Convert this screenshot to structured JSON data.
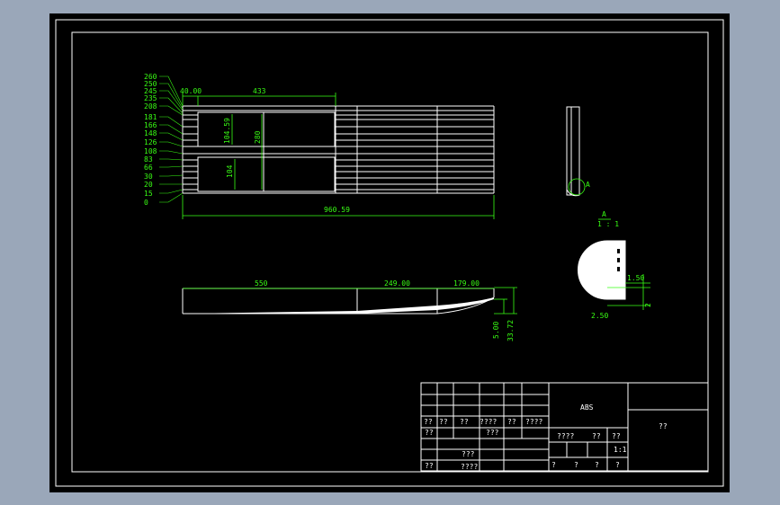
{
  "material": "ABS",
  "part_name": "??",
  "dims": {
    "width_total": "960.59",
    "top_length": "433",
    "top_offset": "40.00",
    "inner_h1": "104.59",
    "inner_h2": "280",
    "inner_h3": "104",
    "seg1": "550",
    "seg2": "249.00",
    "seg3": "179.00",
    "rise_small": "5.00",
    "rise_total": "33.72",
    "detail_w1": "1.50",
    "detail_w2": "2.50",
    "detail_h": "2"
  },
  "detail_label": "A",
  "detail_scale_top": "A",
  "detail_scale_bot": "1 : 1",
  "left_stack": [
    "260",
    "250",
    "245",
    "235",
    "208",
    "181",
    "166",
    "148",
    "126",
    "108",
    "83",
    "66",
    "30",
    "20",
    "15",
    "0"
  ],
  "title_block": {
    "row_signer_1": [
      "??",
      "??",
      "??",
      "????",
      "??",
      "????"
    ],
    "r2_a": "??",
    "r2_b": "???",
    "r3_a": "??",
    "r3_b": "???",
    "r4_a": "????",
    "right_a": [
      "????",
      "??",
      "??"
    ],
    "right_b": "1:1",
    "right_c": [
      "?",
      "?",
      "?",
      "?"
    ]
  }
}
